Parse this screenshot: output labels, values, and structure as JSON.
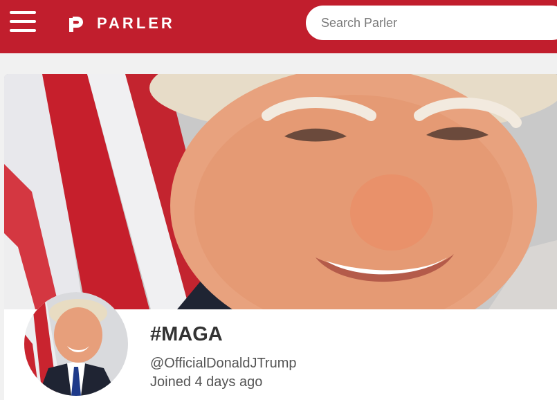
{
  "header": {
    "brand_name": "PARLER",
    "brand_color": "#c11e2d",
    "menu_icon": "hamburger-menu-icon",
    "logo_icon": "parler-p-logo-icon"
  },
  "search": {
    "placeholder": "Search Parler",
    "value": ""
  },
  "profile": {
    "banner_image": "portrait-close-up-with-american-flag",
    "avatar_image": "portrait-with-american-flag",
    "display_name": "#MAGA",
    "handle": "@OfficialDonaldJTrump",
    "joined": "Joined 4 days ago"
  }
}
